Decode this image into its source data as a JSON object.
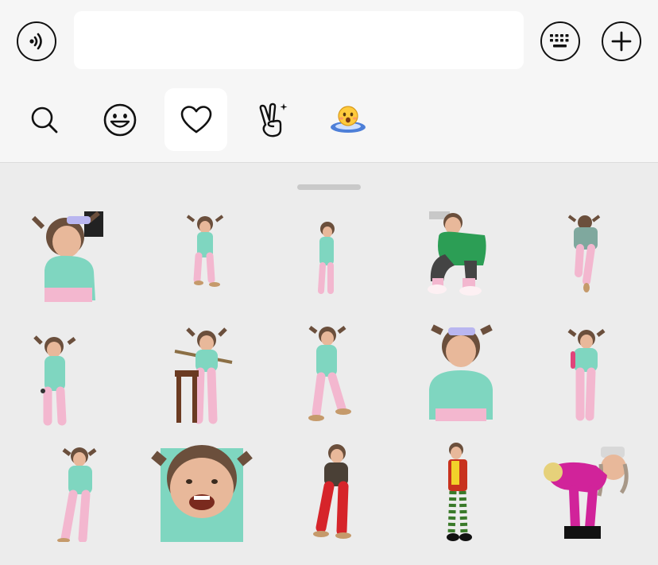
{
  "input": {
    "value": "",
    "placeholder": ""
  },
  "toolbar": {
    "voice_icon": "voice-wave-icon",
    "keyboard_icon": "keyboard-icon",
    "plus_icon": "plus-icon"
  },
  "tabs": [
    {
      "icon": "search-icon",
      "active": false
    },
    {
      "icon": "smiley-icon",
      "active": false
    },
    {
      "icon": "heart-icon",
      "active": true
    },
    {
      "icon": "peace-hand-icon",
      "active": false
    },
    {
      "icon": "sticker-pack-icon",
      "active": false
    }
  ],
  "stickers": {
    "count": 15,
    "colors": {
      "sweater": "#7fd6c0",
      "pants": "#f3b7cf",
      "hair": "#6b4f3c",
      "skin": "#e8b89a",
      "green_jacket": "#2c9e55",
      "magenta": "#d1239a",
      "red_pants": "#d6242a"
    }
  }
}
